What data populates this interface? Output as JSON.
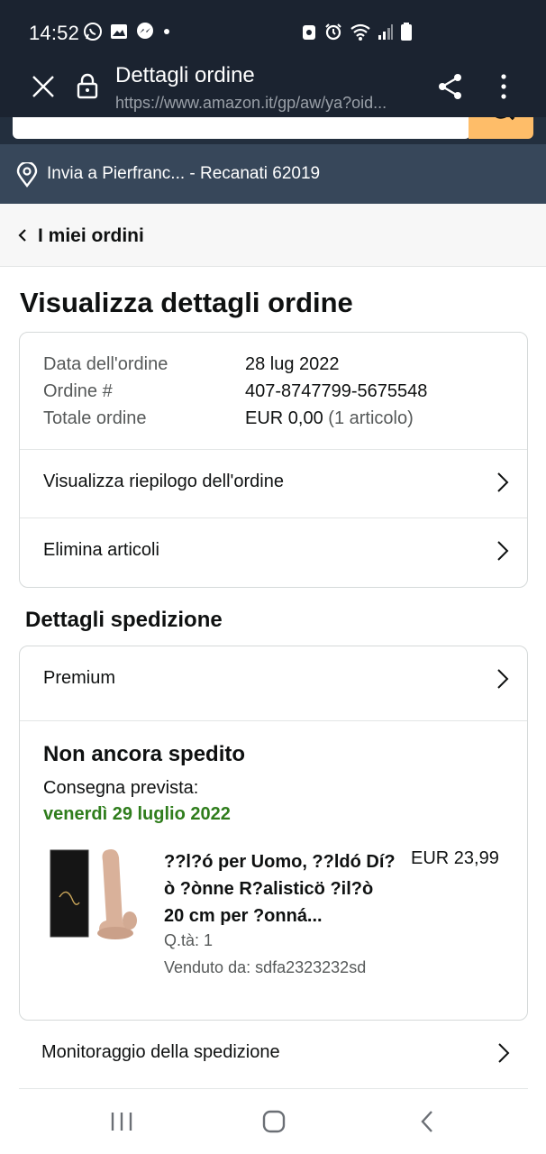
{
  "status_bar": {
    "time": "14:52",
    "left_icons": [
      "whatsapp-icon",
      "gallery-icon",
      "messenger-icon",
      "dot-icon"
    ],
    "right_icons": [
      "data-saver-icon",
      "alarm-icon",
      "wifi-icon",
      "signal-icon",
      "battery-icon"
    ]
  },
  "browser": {
    "title": "Dettagli ordine",
    "url": "https://www.amazon.it/gp/aw/ya?oid..."
  },
  "deliver_to": {
    "text": "Invia a Pierfranc... - Recanati 62019"
  },
  "breadcrumb": {
    "label": "I miei ordini"
  },
  "page_title": "Visualizza dettagli ordine",
  "order_summary": {
    "rows": [
      {
        "label": "Data dell'ordine",
        "value": "28 lug 2022"
      },
      {
        "label": "Ordine #",
        "value": "407-8747799-5675548"
      },
      {
        "label": "Totale ordine",
        "value": "EUR 0,00",
        "extra": "(1 articolo)"
      }
    ],
    "links": [
      "Visualizza riepilogo dell'ordine",
      "Elimina articoli"
    ]
  },
  "shipping": {
    "section_title": "Dettagli spedizione",
    "method": "Premium",
    "status": "Non ancora spedito",
    "eta_label": "Consegna prevista:",
    "eta_date": "venerdì 29 luglio 2022",
    "product": {
      "title": "??l?ó per Uomo, ??ldó Dí?ò ?ònne R?alisticö ?il?ò 20 cm per ?onná...",
      "price": "EUR 23,99",
      "qty": "Q.tà: 1",
      "seller": "Venduto da: sdfa2323232sd"
    },
    "tracking_label": "Monitoraggio della spedizione"
  },
  "colors": {
    "status_bg": "#1b2330",
    "search_button": "#febd69",
    "deliver_bg": "#37475a",
    "eta_green": "#2f7d1c"
  }
}
